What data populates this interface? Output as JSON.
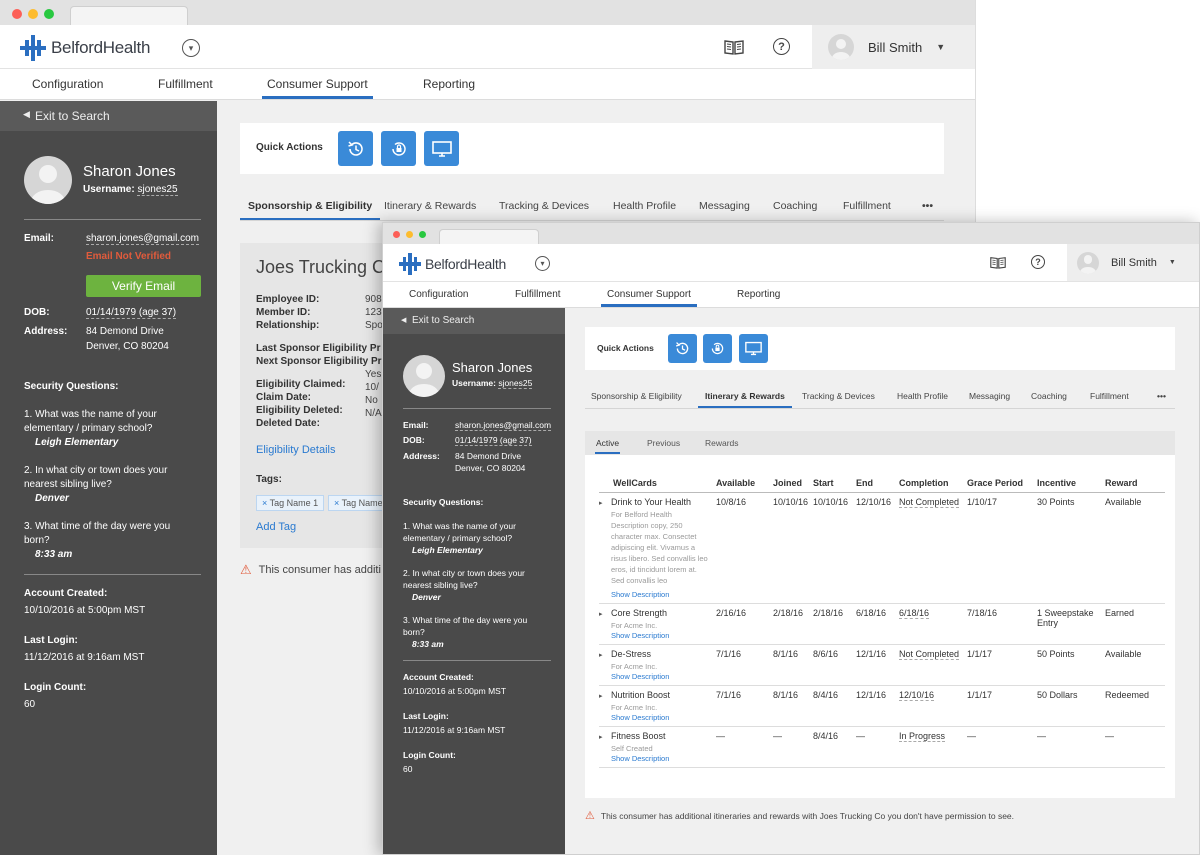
{
  "app": {
    "brand": "BelfordHealth",
    "user": "Bill Smith",
    "nav": [
      "Configuration",
      "Fulfillment",
      "Consumer Support",
      "Reporting"
    ],
    "active_nav": "Consumer Support"
  },
  "sidebar": {
    "exit_label": "Exit to Search",
    "name": "Sharon Jones",
    "username_label": "Username:",
    "username": "sjones25",
    "email_label": "Email:",
    "email": "sharon.jones@gmail.com",
    "email_status": "Email Not Verified",
    "verify_button": "Verify Email",
    "dob_label": "DOB:",
    "dob": "01/14/1979 (age 37)",
    "address_label": "Address:",
    "address_line1": "84 Demond Drive",
    "address_line2": "Denver, CO 80204",
    "security_title": "Security Questions:",
    "questions": [
      {
        "q": "1.  What was the name of your elementary / primary school?",
        "a": "Leigh Elementary"
      },
      {
        "q": "2.  In what city or town does your nearest sibling live?",
        "a": "Denver"
      },
      {
        "q": "3.  What time of the day were you born?",
        "a": "8:33 am"
      }
    ],
    "account_created_label": "Account Created:",
    "account_created": "10/10/2016 at 5:00pm MST",
    "last_login_label": "Last Login:",
    "last_login": "11/12/2016 at 9:16am MST",
    "login_count_label": "Login Count:",
    "login_count": "60"
  },
  "quick_actions": {
    "title": "Quick Actions",
    "icons": [
      "history-icon",
      "lock-reset-icon",
      "monitor-icon"
    ]
  },
  "profile_tabs": [
    "Sponsorship & Eligibility",
    "Itinerary & Rewards",
    "Tracking & Devices",
    "Health Profile",
    "Messaging",
    "Coaching",
    "Fulfillment",
    "•••"
  ],
  "back_window": {
    "active_tab": "Sponsorship & Eligibility",
    "company": "Joes Trucking C",
    "fields": [
      {
        "label": "Employee ID:",
        "value": "908"
      },
      {
        "label": "Member ID:",
        "value": "123"
      },
      {
        "label": "Relationship:",
        "value": "Spo"
      },
      {
        "label": "Last Sponsor Eligibility Pr",
        "value": ""
      },
      {
        "label": "Next Sponsor Eligibility Pr",
        "value": ""
      },
      {
        "label": "Eligibility Claimed:",
        "value": "Yes"
      },
      {
        "label": "Claim Date:",
        "value": "10/"
      },
      {
        "label": "Eligibility Deleted:",
        "value": "No"
      },
      {
        "label": "Deleted Date:",
        "value": "N/A"
      }
    ],
    "eligibility_link": "Eligibility Details",
    "tags_label": "Tags:",
    "tags": [
      "Tag Name 1",
      "Tag Name"
    ],
    "add_tag": "Add Tag",
    "notice": "This consumer has additi"
  },
  "front_window": {
    "active_tab": "Itinerary & Rewards",
    "subtabs": [
      "Active",
      "Previous",
      "Rewards"
    ],
    "columns": [
      "WellCards",
      "Available",
      "Joined",
      "Start",
      "End",
      "Completion",
      "Grace Period",
      "Incentive",
      "Reward"
    ],
    "rows": [
      {
        "name": "Drink to Your Health",
        "desc": "For Belford Health Description copy, 250 character max. Consectet adipiscing elit. Vivamus a risus libero. Sed convallis leo eros, id tincidunt lorem at. Sed convallis leo",
        "show": "Show Description",
        "available": "10/8/16",
        "joined": "10/10/16",
        "start": "10/10/16",
        "end": "12/10/16",
        "completion": "Not Completed",
        "grace": "1/10/17",
        "incentive": "30 Points",
        "reward": "Available"
      },
      {
        "name": "Core Strength",
        "desc": "For Acme Inc.",
        "show": "Show Description",
        "available": "2/16/16",
        "joined": "2/18/16",
        "start": "2/18/16",
        "end": "6/18/16",
        "completion": "6/18/16",
        "grace": "7/18/16",
        "incentive": "1 Sweepstake Entry",
        "reward": "Earned"
      },
      {
        "name": "De-Stress",
        "desc": "For Acme Inc.",
        "show": "Show Description",
        "available": "7/1/16",
        "joined": "8/1/16",
        "start": "8/6/16",
        "end": "12/1/16",
        "completion": "Not Completed",
        "grace": "1/1/17",
        "incentive": "50 Points",
        "reward": "Available"
      },
      {
        "name": "Nutrition Boost",
        "desc": "For Acme Inc.",
        "show": "Show Description",
        "available": "7/1/16",
        "joined": "8/1/16",
        "start": "8/4/16",
        "end": "12/1/16",
        "completion": "12/10/16",
        "grace": "1/1/17",
        "incentive": "50 Dollars",
        "reward": "Redeemed"
      },
      {
        "name": "Fitness Boost",
        "desc": "Self Created",
        "show": "Show Description",
        "available": "—",
        "joined": "—",
        "start": "8/4/16",
        "end": "—",
        "completion": "In Progress",
        "grace": "—",
        "incentive": "—",
        "reward": "—"
      }
    ],
    "notice": "This consumer has additional itineraries and rewards with Joes Trucking Co you don't have permission to see."
  },
  "colors": {
    "accent": "#2a6ec0",
    "sidebar": "#4a4a4a",
    "quick_action": "#3a8ad8",
    "verify": "#6db33f",
    "warning": "#e15b3c"
  }
}
